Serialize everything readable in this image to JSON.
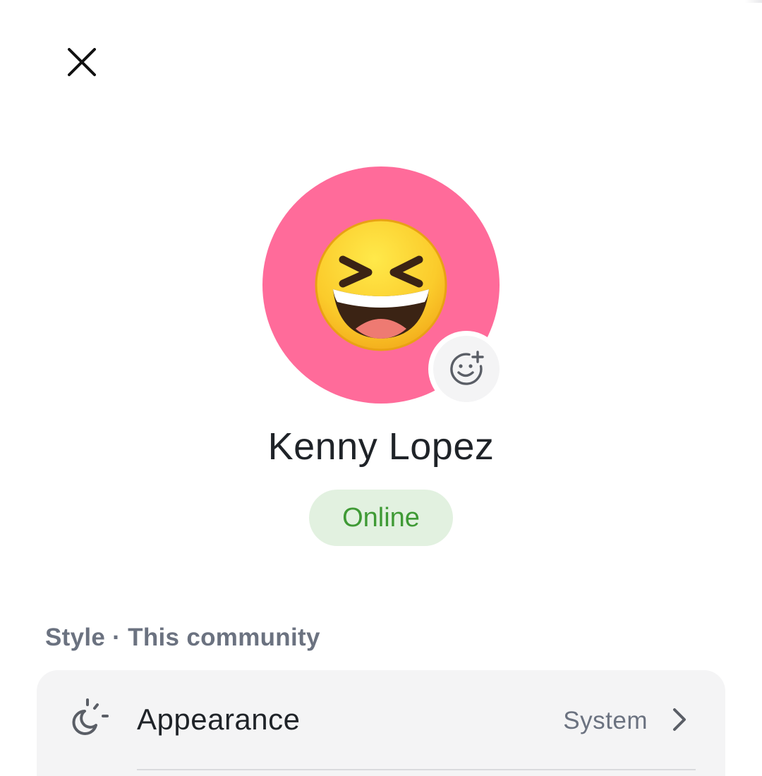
{
  "header": {
    "close_icon": "close-icon"
  },
  "profile": {
    "name": "Kenny Lopez",
    "status": "Online",
    "avatar_color": "#FF6B9A",
    "avatar_emoji": "grinning-squinting-face",
    "add_emoji_icon": "smiley-plus-icon"
  },
  "colors": {
    "status_text": "#3F9A35",
    "status_bg": "#E2F1E0",
    "card_bg": "#F4F4F5",
    "muted_text": "#6B7280"
  },
  "section": {
    "title": "Style · This community"
  },
  "settings": [
    {
      "label": "Appearance",
      "value": "System",
      "icon": "moon-sun-icon"
    }
  ]
}
